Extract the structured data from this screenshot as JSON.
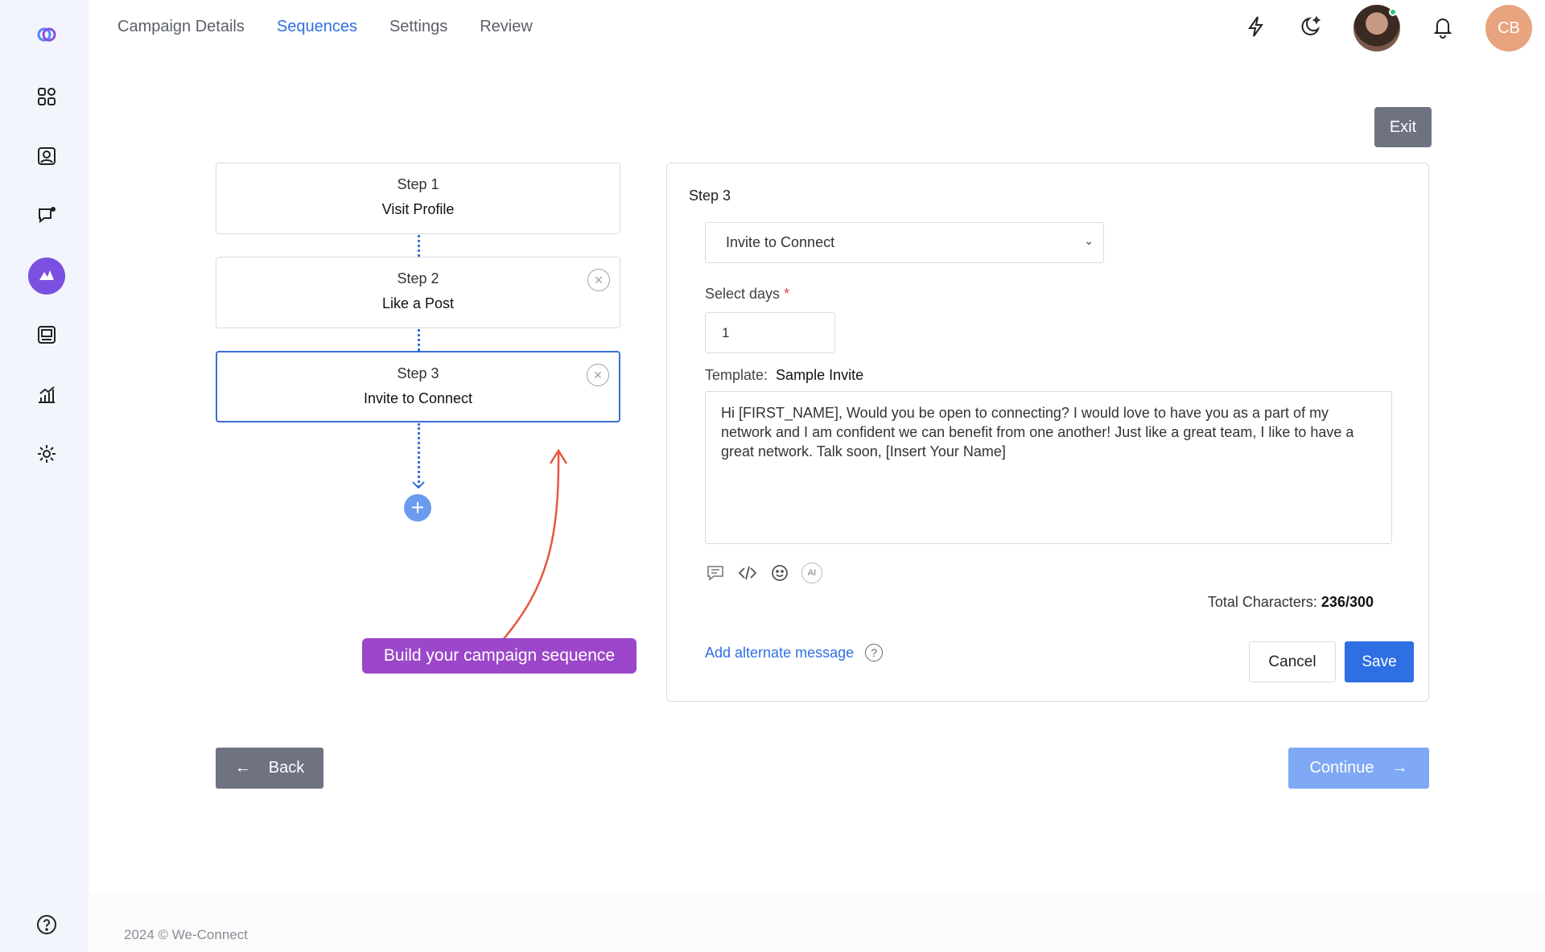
{
  "nav": {
    "tabs": [
      {
        "label": "Campaign Details"
      },
      {
        "label": "Sequences"
      },
      {
        "label": "Settings"
      },
      {
        "label": "Review"
      }
    ],
    "active_tab": "Sequences",
    "user_initials": "CB"
  },
  "sidebar": {
    "icons": [
      "logo-icon",
      "dashboard-icon",
      "contacts-icon",
      "messages-icon",
      "campaigns-icon",
      "inbox-icon",
      "analytics-icon",
      "settings-icon",
      "help-icon"
    ],
    "active": "campaigns-icon"
  },
  "actions": {
    "exit_label": "Exit",
    "back_label": "Back",
    "continue_label": "Continue"
  },
  "steps": [
    {
      "label": "Step 1",
      "name": "Visit Profile"
    },
    {
      "label": "Step 2",
      "name": "Like a Post"
    },
    {
      "label": "Step 3",
      "name": "Invite to Connect"
    }
  ],
  "callout": "Build your campaign sequence",
  "editor": {
    "title": "Step 3",
    "action_value": "Invite to Connect",
    "days_label": "Select days",
    "days_required": "*",
    "days_value": "1",
    "template_label": "Template:",
    "template_name": "Sample Invite",
    "message": "Hi [FIRST_NAME], Would you be open to connecting? I would love to have you as a part of my network and I am confident we can benefit from one another! Just like a great team, I like to have a great network. Talk soon, [Insert Your Name]",
    "ai_label": "AI",
    "total_label": "Total Characters:",
    "total_value": "236/300",
    "alt_link": "Add alternate message",
    "cancel_label": "Cancel",
    "save_label": "Save"
  },
  "footer": "2024 © We-Connect",
  "colors": {
    "accent": "#2f6fe4",
    "callout": "#9c47c9",
    "sidebar_active": "#7b4fe0"
  }
}
